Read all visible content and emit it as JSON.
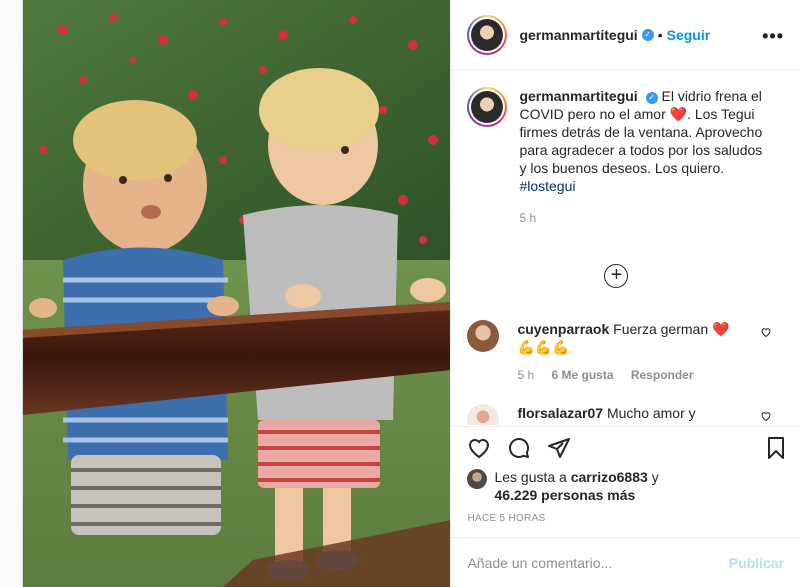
{
  "post": {
    "username": "germanmartitegui",
    "follow_label": "Seguir",
    "more_icon": "more-options-icon",
    "caption": {
      "username": "germanmartitegui",
      "text_part1": "El vidrio frena el COVID pero no el amor",
      "emoji": "❤️",
      "text_part2": ". Los Tegui firmes detrás de la ventana. Aprovecho para agradecer a todos por los saludos y los buenos deseos. Los quiero.",
      "hashtag": "#lostegui",
      "time": "5 h"
    },
    "comments": [
      {
        "username": "cuyenparraok",
        "text": "Fuerza german",
        "emoji": "❤️",
        "emoji_line": "💪💪💪",
        "time": "5 h",
        "likes": "6 Me gusta",
        "reply": "Responder"
      },
      {
        "username": "florsalazar07",
        "text": "Mucho amor y"
      }
    ],
    "likes": {
      "prefix": "Les gusta a",
      "user": "carrizo6883",
      "and": "y",
      "others": "46.229 personas más"
    },
    "time_ago": "HACE 5 HORAS",
    "add_comment_placeholder": "Añade un comentario...",
    "publish_label": "Publicar"
  },
  "colors": {
    "accent": "#0095f6",
    "verified": "#3897f0",
    "publish_disabled": "#b2dffc",
    "secondary_text": "#8e8e8e"
  }
}
